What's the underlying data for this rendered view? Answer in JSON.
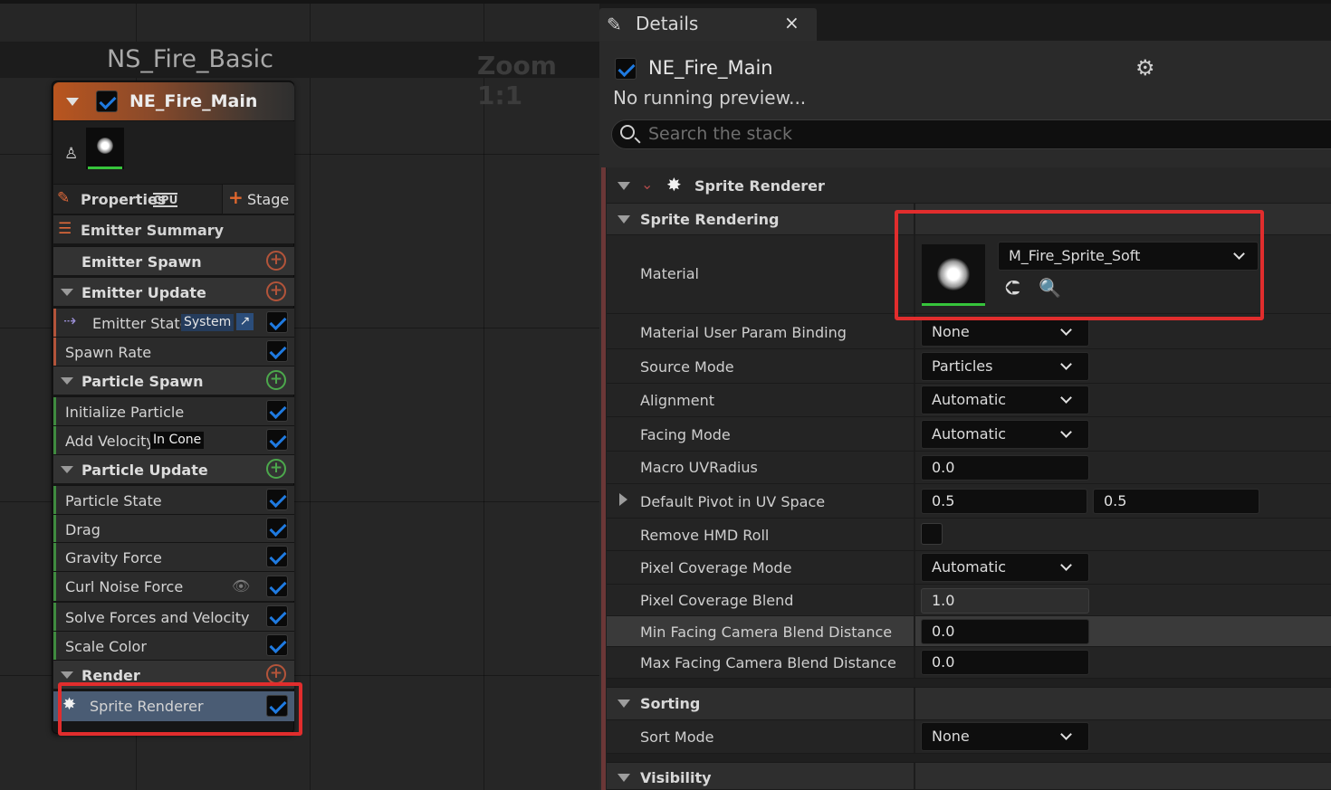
{
  "graph": {
    "title": "NS_Fire_Basic",
    "zoom": "Zoom 1:1",
    "node": {
      "title": "NE_Fire_Main",
      "properties_label": "Properties",
      "cpu_badge": "CPU",
      "stage_label": "Stage",
      "rows": [
        {
          "label": "Emitter Summary"
        },
        {
          "label": "Emitter Spawn"
        },
        {
          "label": "Emitter Update"
        },
        {
          "label": "Emitter State",
          "tag": "System"
        },
        {
          "label": "Spawn Rate"
        },
        {
          "label": "Particle Spawn"
        },
        {
          "label": "Initialize Particle"
        },
        {
          "label": "Add Velocity",
          "tag": "In Cone"
        },
        {
          "label": "Particle Update"
        },
        {
          "label": "Particle State"
        },
        {
          "label": "Drag"
        },
        {
          "label": "Gravity Force"
        },
        {
          "label": "Curl Noise Force"
        },
        {
          "label": "Solve Forces and Velocity"
        },
        {
          "label": "Scale Color"
        },
        {
          "label": "Render"
        },
        {
          "label": "Sprite Renderer"
        }
      ]
    }
  },
  "details": {
    "tab_title": "Details",
    "close_glyph": "×",
    "emitter_title": "NE_Fire_Main",
    "status": "No running preview...",
    "search_placeholder": "Search the stack",
    "module_title": "Sprite Renderer",
    "sections": {
      "sprite_rendering": "Sprite Rendering",
      "sorting": "Sorting",
      "visibility": "Visibility"
    },
    "material": {
      "label": "Material",
      "value": "M_Fire_Sprite_Soft"
    },
    "properties": [
      {
        "label": "Material User Param Binding",
        "value": "None"
      },
      {
        "label": "Source Mode",
        "value": "Particles"
      },
      {
        "label": "Alignment",
        "value": "Automatic"
      },
      {
        "label": "Facing Mode",
        "value": "Automatic"
      },
      {
        "label": "Macro UVRadius",
        "value": "0.0"
      },
      {
        "label": "Default Pivot in UV Space",
        "value": "0.5",
        "value2": "0.5"
      },
      {
        "label": "Remove HMD Roll",
        "value": ""
      },
      {
        "label": "Pixel Coverage Mode",
        "value": "Automatic"
      },
      {
        "label": "Pixel Coverage Blend",
        "value": "1.0"
      },
      {
        "label": "Min Facing Camera Blend Distance",
        "value": "0.0"
      },
      {
        "label": "Max Facing Camera Blend Distance",
        "value": "0.0"
      }
    ],
    "sort_mode": {
      "label": "Sort Mode",
      "value": "None"
    }
  },
  "colors": {
    "accent_blue": "#1f7ae0",
    "highlight_red": "#e12d2d",
    "emitter_orange": "#b9551f",
    "selected_row": "#4a5c74"
  }
}
